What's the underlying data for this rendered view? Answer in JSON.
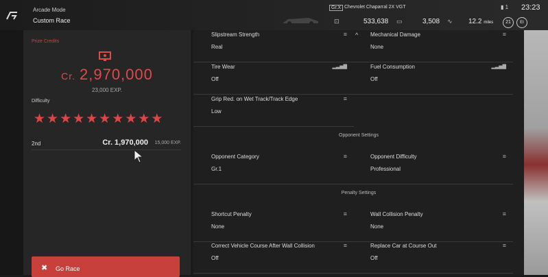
{
  "header": {
    "mode": "Arcade Mode",
    "race": "Custom Race",
    "car_class": "Gr.X",
    "car_name": "Chevrolet Chaparral 2X VGT",
    "stat_money": "533,638",
    "stat_miles": "3,508",
    "distance": "12.2",
    "distance_unit": "miles",
    "time": "23:23",
    "battery": "1",
    "badge_level": "21",
    "badge_ei": "EI"
  },
  "left": {
    "prize_label": "Prize Credits",
    "credits_prefix": "Cr.",
    "credits_amount": "2,970,000",
    "exp": "23,000 EXP.",
    "difficulty_label": "Difficulty",
    "stars": "★★★★★★★★★★",
    "difficulty_stars": 10,
    "second_place": "2nd",
    "second_credits": "Cr.  1,970,000",
    "second_exp": "15,000 EXP.",
    "go_label": "Go Race"
  },
  "settings": {
    "slipstream_title": "Slipstream Strength",
    "slipstream_value": "Real",
    "mechanical_title": "Mechanical Damage",
    "mechanical_value": "None",
    "tire_title": "Tire Wear",
    "tire_value": "Off",
    "fuel_title": "Fuel Consumption",
    "fuel_value": "Off",
    "grip_title": "Grip Red. on Wet Track/Track Edge",
    "grip_value": "Low",
    "opponent_section": "Opponent Settings",
    "opp_category_title": "Opponent Category",
    "opp_category_value": "Gr.1",
    "opp_difficulty_title": "Opponent Difficulty",
    "opp_difficulty_value": "Professional",
    "penalty_section": "Penalty Settings",
    "shortcut_title": "Shortcut Penalty",
    "shortcut_value": "None",
    "wall_title": "Wall Collision Penalty",
    "wall_value": "None",
    "correct_title": "Correct Vehicle Course After Wall Collision",
    "correct_value": "Off",
    "replace_title": "Replace Car at Course Out",
    "replace_value": "Off"
  },
  "icons": {
    "menu": "≡",
    "bars": "▂▃▅▇",
    "caret": "^"
  },
  "colors": {
    "accent_red": "#e04a4a",
    "button_red": "#c8403b"
  }
}
